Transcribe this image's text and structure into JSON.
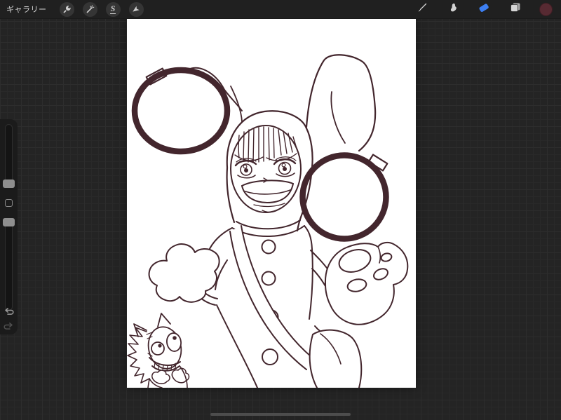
{
  "top_toolbar": {
    "gallery_label": "ギャラリー",
    "left_tools": [
      {
        "id": "actions",
        "icon": "wrench-icon"
      },
      {
        "id": "adjustments",
        "icon": "magic-wand-icon"
      },
      {
        "id": "selection",
        "icon": "selection-s-icon",
        "glyph": "S"
      },
      {
        "id": "transform",
        "icon": "transform-arrow-icon"
      }
    ],
    "right_tools": [
      {
        "id": "paint",
        "icon": "paintbrush-icon",
        "active": false
      },
      {
        "id": "smudge",
        "icon": "smudge-finger-icon",
        "active": false
      },
      {
        "id": "erase",
        "icon": "eraser-icon",
        "active": true
      },
      {
        "id": "layers",
        "icon": "layers-icon",
        "active": false
      },
      {
        "id": "color",
        "icon": "color-swatch",
        "active": false
      }
    ],
    "active_tool_color": "#3d7ff2",
    "color_swatch_color": "#572a32"
  },
  "left_sidebar": {
    "brush_size_slider": {
      "name": "brush-size",
      "handle_position_pct": 93
    },
    "opacity_slider": {
      "name": "opacity",
      "handle_position_pct": 4
    },
    "modify_button": {
      "name": "modify"
    },
    "undo_icon": "undo-arrow-icon",
    "redo_icon": "redo-arrow-icon"
  },
  "canvas": {
    "background_color": "#ffffff",
    "line_color": "#43262d",
    "artwork_elements": [
      "left-thick-ring",
      "right-thick-ring",
      "bunny-hood",
      "bunny-ear",
      "character-face",
      "cloud-mitten",
      "paw-mitten",
      "crossbody-sash",
      "coat-buttons",
      "hip-pouch",
      "grinning-cat"
    ]
  },
  "home_indicator": {
    "visible": true
  }
}
